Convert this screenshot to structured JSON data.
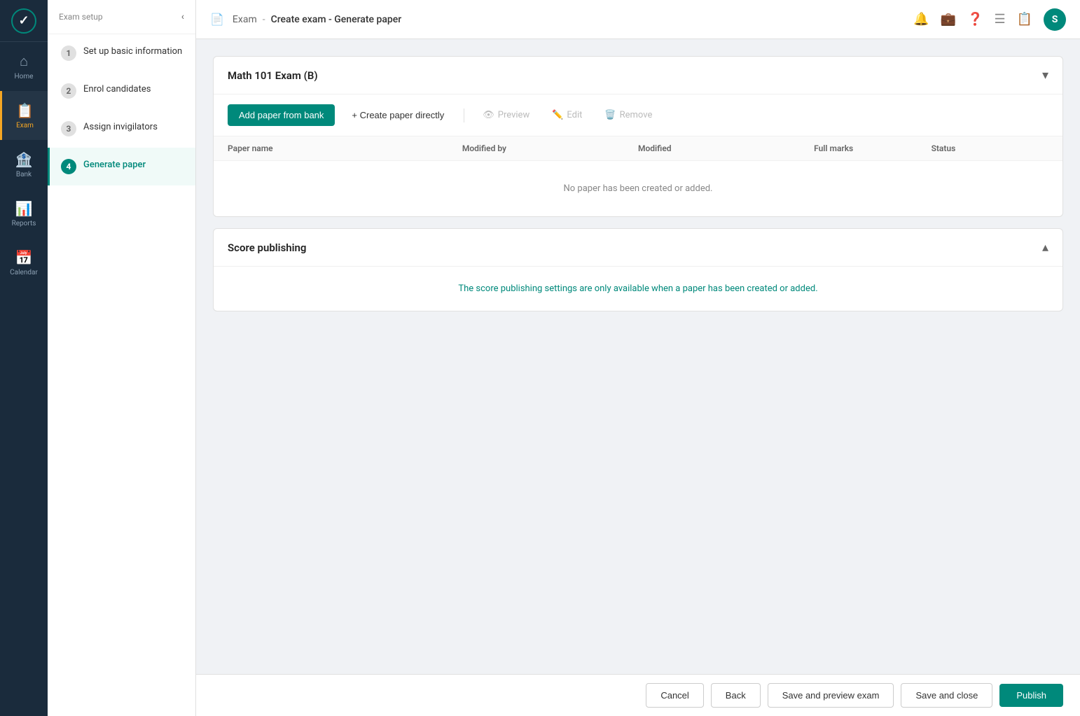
{
  "app": {
    "logo_text": "✓",
    "title": "Create exam - Generate paper"
  },
  "topbar": {
    "breadcrumb_parent": "Exam",
    "breadcrumb_separator": "|",
    "breadcrumb_current": "Create exam - Generate paper",
    "actions": {
      "notification_icon": "🔔",
      "briefcase_icon": "💼",
      "help_icon": "?",
      "list_icon": "☰",
      "clipboard_icon": "📋",
      "avatar_text": "S"
    }
  },
  "sidebar": {
    "header_label": "Exam setup",
    "collapse_icon": "‹",
    "steps": [
      {
        "number": "1",
        "label": "Set up basic information",
        "active": false
      },
      {
        "number": "2",
        "label": "Enrol candidates",
        "active": false
      },
      {
        "number": "3",
        "label": "Assign invigilators",
        "active": false
      },
      {
        "number": "4",
        "label": "Generate paper",
        "active": true
      }
    ]
  },
  "nav": {
    "items": [
      {
        "id": "home",
        "icon": "⌂",
        "label": "Home",
        "active": false
      },
      {
        "id": "exam",
        "icon": "📋",
        "label": "Exam",
        "active": true
      },
      {
        "id": "bank",
        "icon": "🏦",
        "label": "Bank",
        "active": false
      },
      {
        "id": "reports",
        "icon": "📊",
        "label": "Reports",
        "active": false
      },
      {
        "id": "calendar",
        "icon": "📅",
        "label": "Calendar",
        "active": false
      }
    ]
  },
  "paper_section": {
    "title": "Math 101 Exam (B)",
    "toggle_icon": "▾",
    "toolbar": {
      "add_from_bank_label": "Add paper from bank",
      "create_directly_label": "+ Create paper directly",
      "preview_label": "Preview",
      "edit_label": "Edit",
      "remove_label": "Remove"
    },
    "table": {
      "columns": [
        "Paper name",
        "Modified by",
        "Modified",
        "Full marks",
        "Status"
      ],
      "empty_message": "No paper has been created or added."
    }
  },
  "score_section": {
    "title": "Score publishing",
    "toggle_icon": "▴",
    "info_message": "The score publishing settings are only available when a paper has been created or added."
  },
  "footer": {
    "cancel_label": "Cancel",
    "back_label": "Back",
    "save_preview_label": "Save and preview exam",
    "save_close_label": "Save and close",
    "publish_label": "Publish"
  }
}
